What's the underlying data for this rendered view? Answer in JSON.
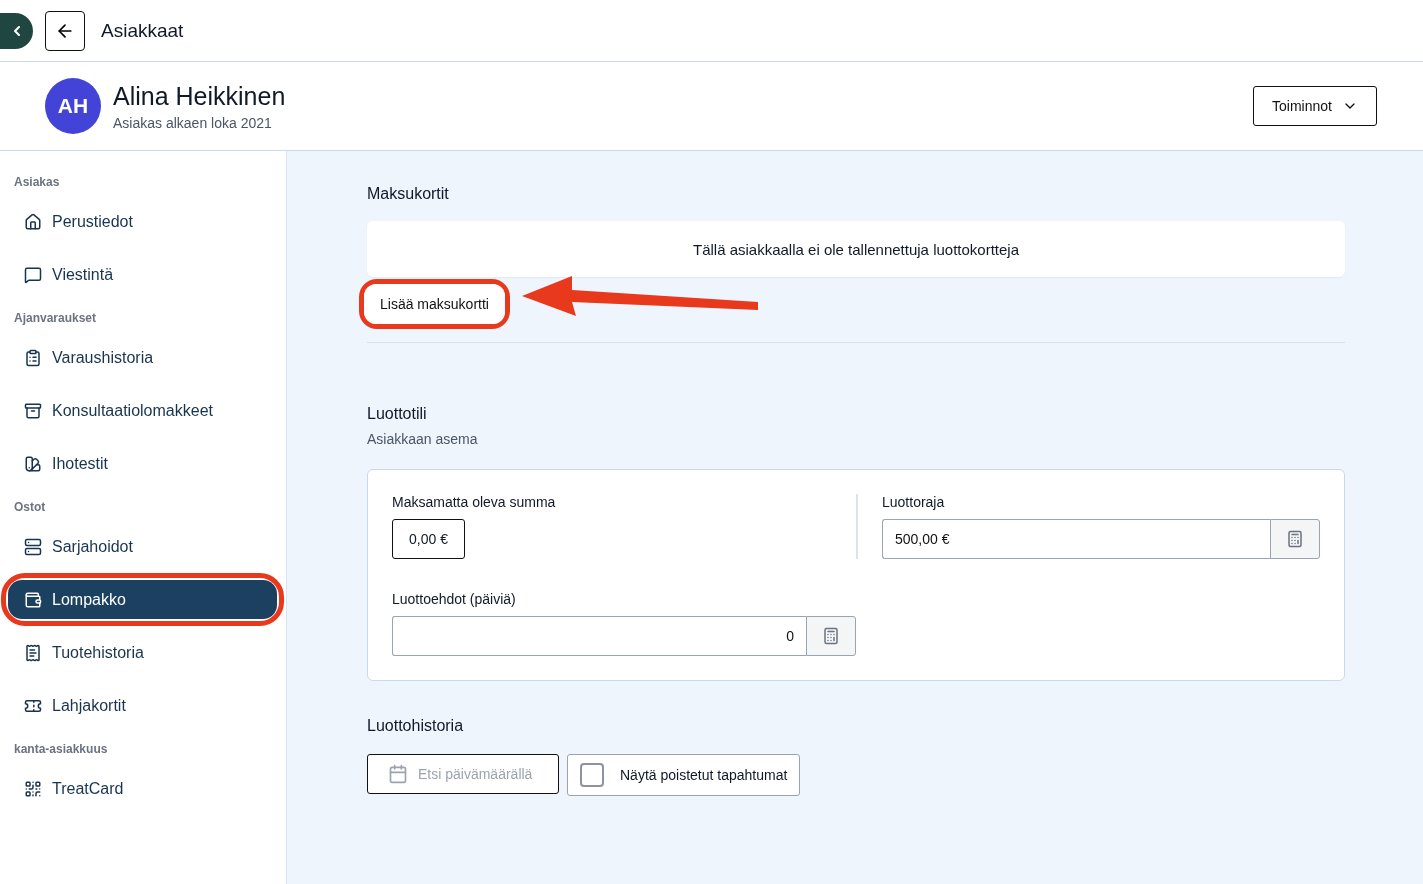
{
  "topbar": {
    "title": "Asiakkaat"
  },
  "customer": {
    "initials": "AH",
    "name": "Alina Heikkinen",
    "subtitle": "Asiakas alkaen loka 2021",
    "actions_button": "Toiminnot"
  },
  "sidebar": {
    "sections": [
      {
        "title": "Asiakas",
        "items": [
          {
            "kind": "home",
            "label": "Perustiedot",
            "selected": false,
            "highlighted": false
          },
          {
            "kind": "message",
            "label": "Viestintä",
            "selected": false,
            "highlighted": false
          }
        ]
      },
      {
        "title": "Ajanvaraukset",
        "items": [
          {
            "kind": "clipboard",
            "label": "Varaushistoria",
            "selected": false,
            "highlighted": false
          },
          {
            "kind": "archive",
            "label": "Konsultaatiolomakkeet",
            "selected": false,
            "highlighted": false
          },
          {
            "kind": "swatch",
            "label": "Ihotestit",
            "selected": false,
            "highlighted": false
          }
        ]
      },
      {
        "title": "Ostot",
        "items": [
          {
            "kind": "server",
            "label": "Sarjahoidot",
            "selected": false,
            "highlighted": false
          },
          {
            "kind": "wallet",
            "label": "Lompakko",
            "selected": true,
            "highlighted": true
          },
          {
            "kind": "receipt",
            "label": "Tuotehistoria",
            "selected": false,
            "highlighted": false
          },
          {
            "kind": "ticket",
            "label": "Lahjakortit",
            "selected": false,
            "highlighted": false
          }
        ]
      },
      {
        "title": "kanta-asiakkuus",
        "items": [
          {
            "kind": "qr",
            "label": "TreatCard",
            "selected": false,
            "highlighted": false
          }
        ]
      }
    ]
  },
  "payment_cards": {
    "title": "Maksukortit",
    "empty_message": "Tällä asiakkaalla ei ole tallennettuja luottokortteja",
    "add_button": "Lisää maksukortti",
    "add_button_highlighted": true
  },
  "credit_account": {
    "title": "Luottotili",
    "subtitle": "Asiakkaan asema",
    "outstanding_label": "Maksamatta oleva summa",
    "outstanding_value": "0,00 €",
    "limit_label": "Luottoraja",
    "limit_value": "500,00 €",
    "terms_label": "Luottoehdot (päiviä)",
    "terms_value": "0"
  },
  "credit_history": {
    "title": "Luottohistoria",
    "date_search_placeholder": "Etsi päivämäärällä",
    "show_deleted": {
      "label": "Näytä poistetut tapahtumat",
      "checked": false
    }
  }
}
